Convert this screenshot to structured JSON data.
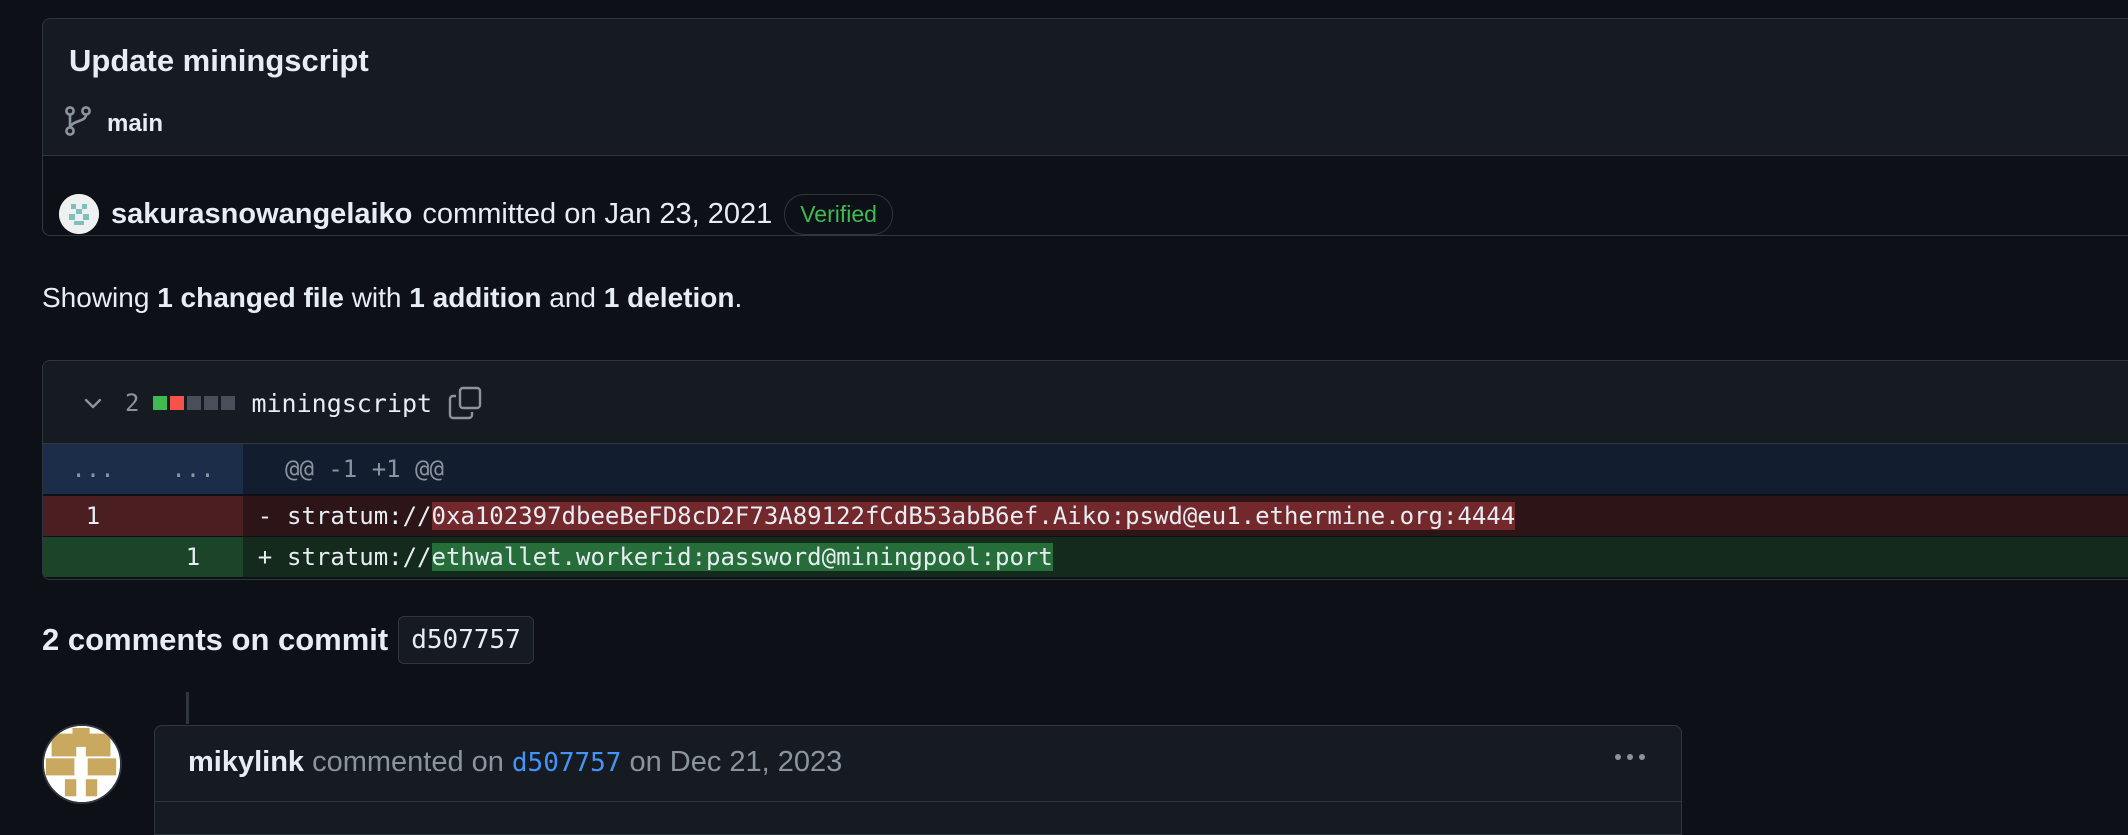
{
  "commit": {
    "title": "Update miningscript",
    "branch": "main",
    "author": "sakurasnowangelaiko",
    "committed_text": "committed on Jan 23, 2021",
    "verified_label": "Verified"
  },
  "summary": {
    "prefix": "Showing",
    "changed_files": "1 changed file",
    "with": "with",
    "additions": "1 addition",
    "and": "and",
    "deletions": "1 deletion",
    "end": "."
  },
  "diff": {
    "count": "2",
    "diffstat": [
      "added",
      "deleted",
      "neutral",
      "neutral",
      "neutral"
    ],
    "file_name": "miningscript",
    "hunk": {
      "old_ln": "...",
      "new_ln": "...",
      "header": "@@ -1 +1 @@"
    },
    "deleted_line": {
      "old_ln": "1",
      "new_ln": "",
      "sign": "-",
      "prefix": "stratum://",
      "changed": "0xa102397dbeeBeFD8cD2F73A89122fCdB53abB6ef.Aiko:pswd@eu1.ethermine.org:4444"
    },
    "added_line": {
      "old_ln": "",
      "new_ln": "1",
      "sign": "+",
      "prefix": "stratum://",
      "changed": "ethwallet.workerid:password@miningpool:port"
    }
  },
  "comments": {
    "title": "2 comments on commit",
    "sha": "d507757",
    "first": {
      "author": "mikylink",
      "action": "commented on",
      "sha": "d507757",
      "date": "on Dec 21, 2023"
    }
  },
  "colors": {
    "background": "#0d1117",
    "verified": "#3fb950",
    "link": "#4493f8",
    "diff_added": "#266d3a",
    "diff_deleted": "#73282c"
  },
  "icons": {
    "branch": "git-branch-icon",
    "chevron": "chevron-down-icon",
    "copy": "copy-icon",
    "kebab": "kebab-horizontal-icon"
  }
}
